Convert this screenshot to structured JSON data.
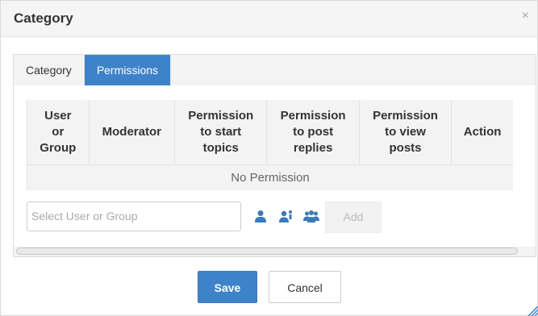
{
  "dialog": {
    "title": "Category",
    "close_glyph": "×"
  },
  "tabs": [
    {
      "label": "Category",
      "active": false
    },
    {
      "label": "Permissions",
      "active": true
    }
  ],
  "table": {
    "headers": [
      [
        "User",
        "or",
        "Group"
      ],
      [
        "Moderator"
      ],
      [
        "Permission",
        "to start",
        "topics"
      ],
      [
        "Permission",
        "to post",
        "replies"
      ],
      [
        "Permission",
        "to view",
        "posts"
      ],
      [
        "Action"
      ]
    ],
    "empty_text": "No Permission"
  },
  "add_row": {
    "select_placeholder": "Select User or Group",
    "icons": [
      "user-icon",
      "user-admin-icon",
      "users-group-icon"
    ],
    "add_label": "Add"
  },
  "footer": {
    "save_label": "Save",
    "cancel_label": "Cancel"
  },
  "colors": {
    "accent": "#3e83c9",
    "header_bg": "#f5f5f5"
  }
}
